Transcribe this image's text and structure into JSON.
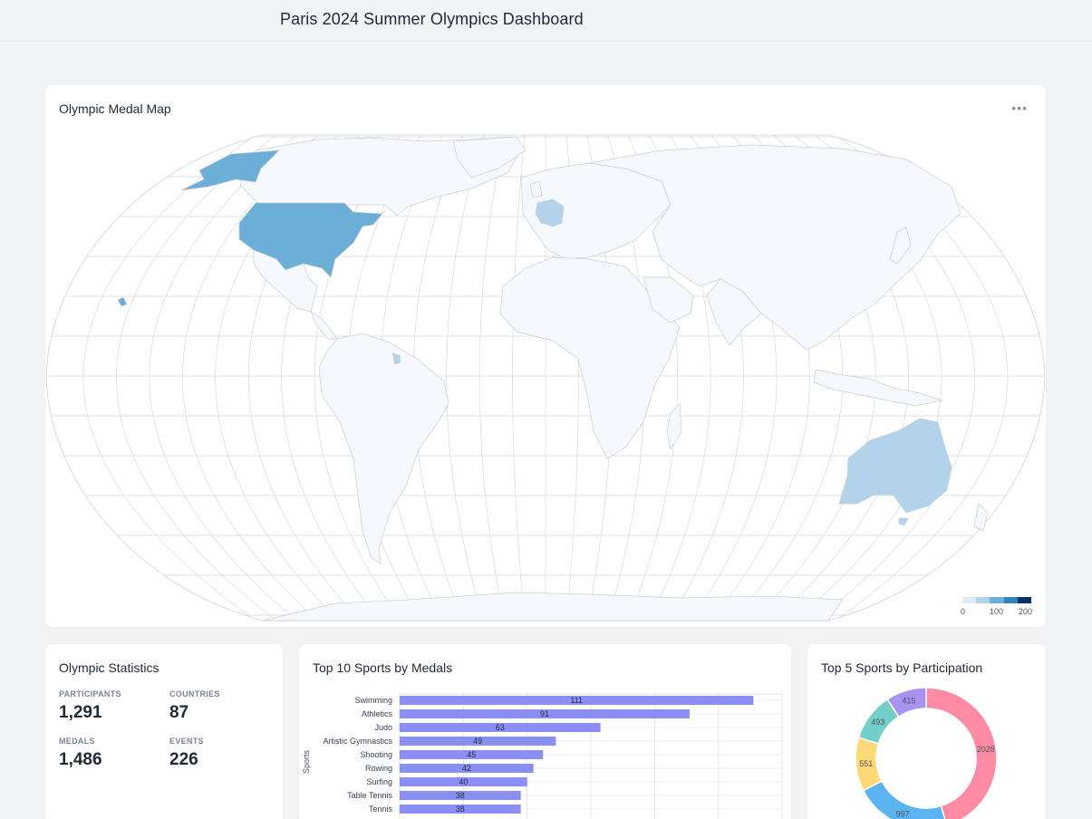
{
  "header": {
    "title": "Paris 2024 Summer Olympics Dashboard"
  },
  "map_card": {
    "title": "Olympic Medal Map",
    "menu_icon": "more-horizontal-icon",
    "legend": {
      "ticks": [
        "0",
        "100",
        "200"
      ],
      "colors": [
        "#deebf7",
        "#b3d3ea",
        "#6baed6",
        "#3182bd",
        "#08306b"
      ]
    },
    "highlighted_countries": [
      "United States",
      "France",
      "Australia"
    ]
  },
  "stats_card": {
    "title": "Olympic Statistics",
    "items": [
      {
        "label": "PARTICIPANTS",
        "value": "1,291"
      },
      {
        "label": "COUNTRIES",
        "value": "87"
      },
      {
        "label": "MEDALS",
        "value": "1,486"
      },
      {
        "label": "EVENTS",
        "value": "226"
      }
    ]
  },
  "bars_card": {
    "title": "Top 10 Sports by Medals",
    "chart_data": {
      "type": "bar",
      "orientation": "horizontal",
      "ylabel": "Sports",
      "categories": [
        "Swimming",
        "Athletics",
        "Judo",
        "Artistic Gymnastics",
        "Shooting",
        "Rowing",
        "Surfing",
        "Table Tennis",
        "Tennis"
      ],
      "values": [
        111,
        91,
        63,
        49,
        45,
        42,
        40,
        38,
        38
      ],
      "xlim": [
        0,
        120
      ],
      "bar_color": "#8b8ff5",
      "grid": true
    }
  },
  "donut_card": {
    "title": "Top 5 Sports by Participation",
    "chart_data": {
      "type": "pie",
      "style": "donut",
      "values": [
        2028,
        997,
        551,
        493,
        415
      ],
      "colors": [
        "#ff8aa3",
        "#5bb3ef",
        "#fdd978",
        "#74cfc9",
        "#a892f2"
      ]
    }
  }
}
